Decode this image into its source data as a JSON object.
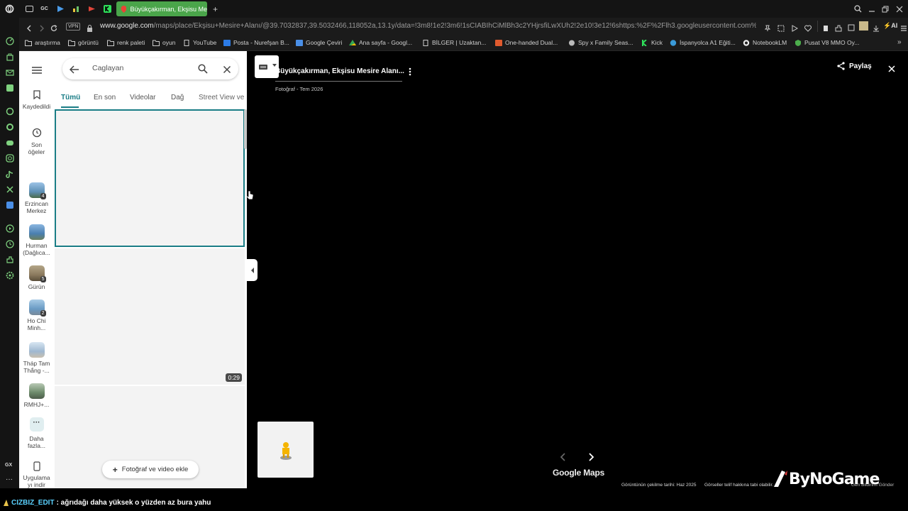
{
  "browser": {
    "tab_title": "Büyükçakırman, Ekşisu Me",
    "vpn_label": "VPN",
    "url_host": "www.google.com",
    "url_path": "/maps/place/Ekşisu+Mesire+Alanı/@39.7032837,39.5032466,118052a,13.1y/data=!3m8!1e2!3m6!1sCIABIhCiMlBh3c2YHjrsfiLwXUh2!2e10!3e12!6shttps:%2F%2Flh3.googleusercontent.com%2Fgps-cs-s%2FA",
    "ai_label": "AI",
    "sidebar_gx": "GX",
    "bookmarks": [
      {
        "label": "araştırma",
        "icon": "folder-icon"
      },
      {
        "label": "görüntü",
        "icon": "folder-icon"
      },
      {
        "label": "renk paleti",
        "icon": "folder-icon"
      },
      {
        "label": "oyun",
        "icon": "folder-icon"
      },
      {
        "label": "YouTube",
        "icon": "page-icon"
      },
      {
        "label": "Posta - Nurefşan B...",
        "icon": "outlook-icon"
      },
      {
        "label": "Google Çeviri",
        "icon": "translate-icon"
      },
      {
        "label": "Ana sayfa - Googl...",
        "icon": "drive-icon"
      },
      {
        "label": "BİLGER | Uzaktan...",
        "icon": "page-icon"
      },
      {
        "label": "One-handed Dual...",
        "icon": "game-icon"
      },
      {
        "label": "Spy x Family Seas...",
        "icon": "spy-icon"
      },
      {
        "label": "Kick",
        "icon": "kick-icon"
      },
      {
        "label": "İspanyolca A1 Eğiti...",
        "icon": "globe-icon"
      },
      {
        "label": "NotebookLM",
        "icon": "notebooklm-icon"
      },
      {
        "label": "Pusat V8 MMO Oy...",
        "icon": "shield-icon"
      }
    ]
  },
  "rail": {
    "saved": "Kaydedildi",
    "recent": "Son öğeler",
    "items": [
      {
        "label": "Erzincan Merkez",
        "badge": "4",
        "color": "#5e8fb5"
      },
      {
        "label": "Hurman (Dağlıca...",
        "badge": "",
        "color": "#4a7fb0"
      },
      {
        "label": "Gürün",
        "badge": "5",
        "color": "#8b7a5e"
      },
      {
        "label": "Ho Chi Minh...",
        "badge": "2",
        "color": "#6a9bc4"
      },
      {
        "label": "Tháp Tam Thắng -...",
        "badge": "",
        "color": "#9fb8d0"
      },
      {
        "label": "RMHJ+...",
        "badge": "",
        "color": "#6c8a6a"
      }
    ],
    "more": "Daha fazla...",
    "app": "Uygulama yı indir"
  },
  "panel": {
    "search_value": "Caglayan",
    "tabs": [
      "Tümü",
      "En son",
      "Videolar",
      "Dağ",
      "Street View ve"
    ],
    "video_duration": "0:29",
    "add_button": "Fotoğraf ve video ekle"
  },
  "viewer": {
    "title": "Büyükçakırman, Ekşisu Mesire Alanı...",
    "subtitle": "Fotoğraf - Tem 2026",
    "share": "Paylaş",
    "logo": "Google Maps",
    "capture_date": "Görüntünün çekilme tarihi: Haz 2025",
    "copyright": "Görseller telif hakkına tabi olabilir.",
    "feedback": "Geri Bildirimi Gönder",
    "watermark": "ByNoGame"
  },
  "chat": {
    "user": "CIZBIZ_EDIT",
    "message": ": ağrıdağı daha yüksek o yüzden az bura yahu"
  },
  "colors": {
    "accent_teal": "#1a7d86",
    "opera_green": "#4aa54a",
    "chat_user": "#5ad1ff"
  }
}
